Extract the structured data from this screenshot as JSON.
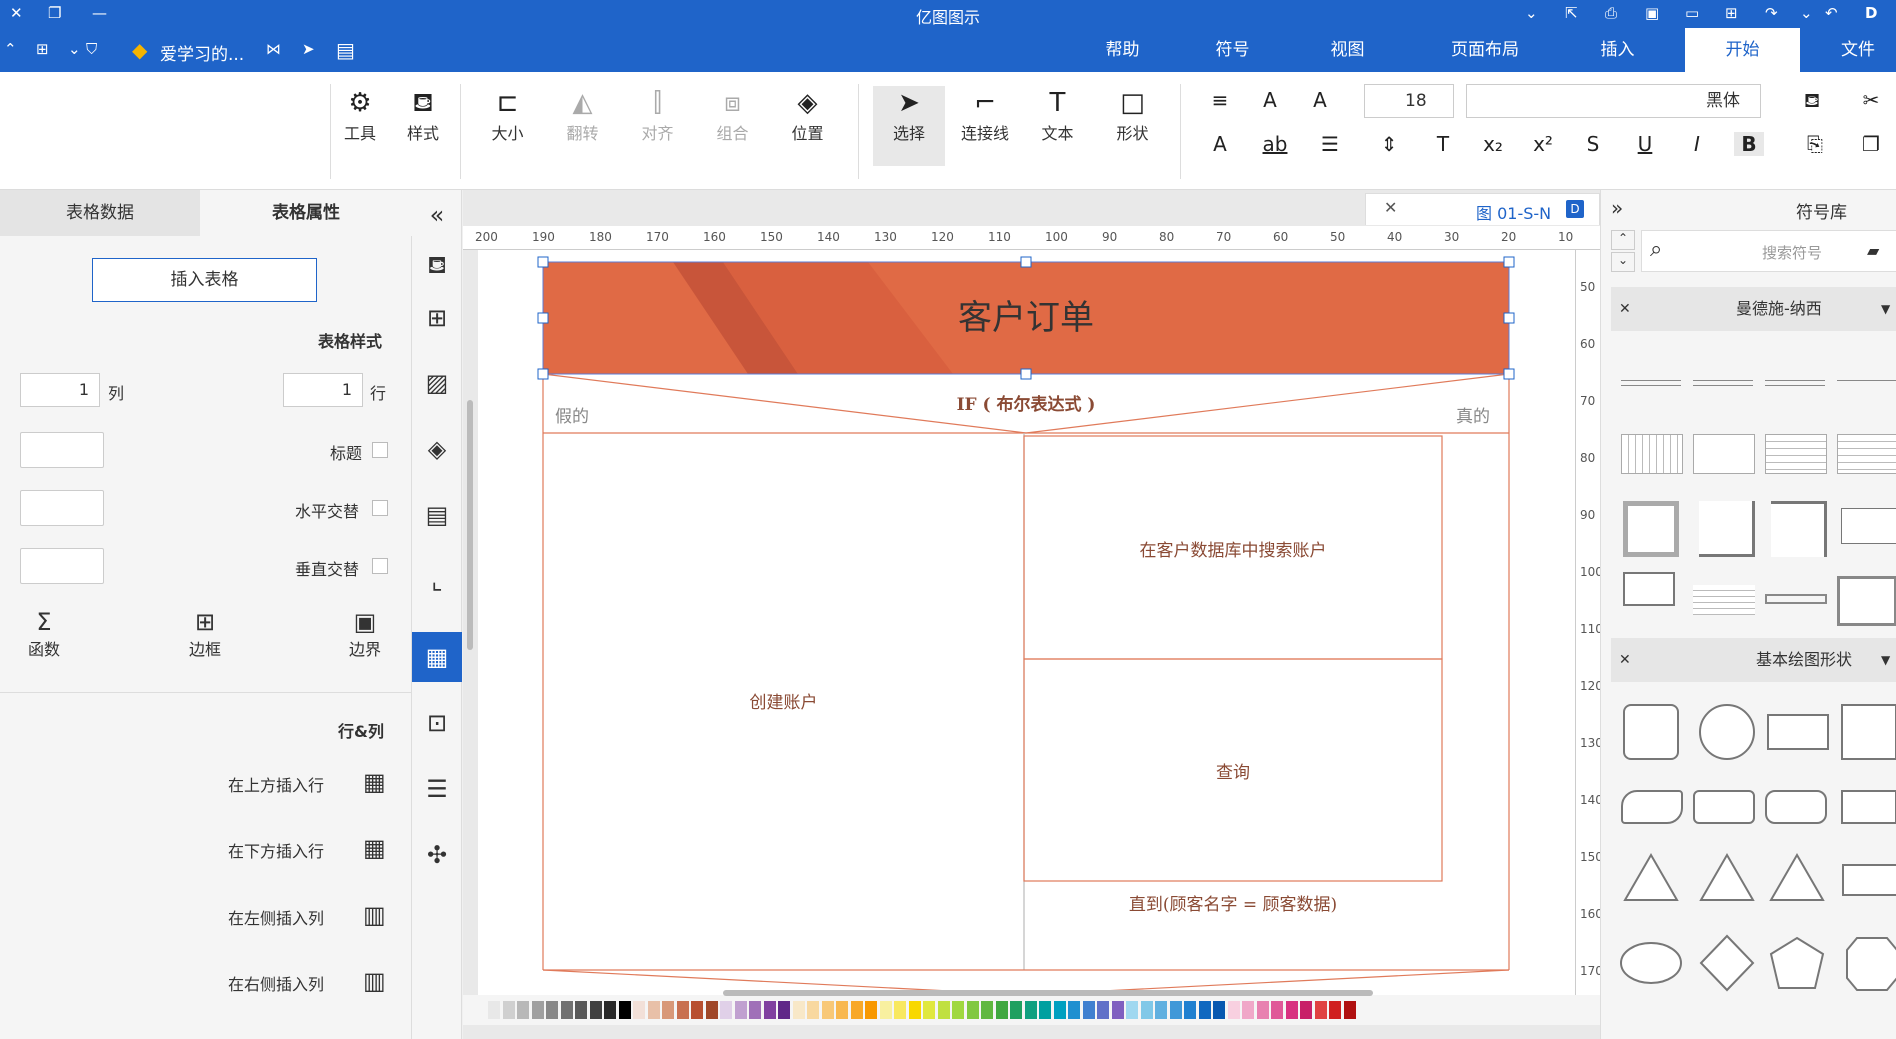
{
  "app": {
    "title": "亿图图示"
  },
  "menubar": {
    "tabs": [
      {
        "label": "开始"
      },
      {
        "label": "插入"
      },
      {
        "label": "页面布局"
      },
      {
        "label": "视图"
      },
      {
        "label": "符号"
      },
      {
        "label": "帮助"
      }
    ],
    "file_label": "文件",
    "tag_label": "爱学习的..."
  },
  "ribbon": {
    "font_name": "黑体",
    "font_size": "18",
    "shape_label": "形状",
    "text_label": "文本",
    "connector_label": "连接线",
    "select_label": "选择",
    "position_label": "位置",
    "group_label": "组合",
    "align_label": "对齐",
    "rotate_label": "翻转",
    "size_label": "大小",
    "style_label": "样式",
    "tools_label": "工具"
  },
  "left_panel": {
    "tab_props": "表格属性",
    "tab_data": "表格数据",
    "insert_table": "插入表格",
    "table_style_title": "表格样式",
    "row_label": "行",
    "row_value": "1",
    "col_label": "列",
    "col_value": "1",
    "header_label": "标题",
    "h_alt_label": "水平交替",
    "v_alt_label": "垂直交替",
    "border_label": "边界",
    "frame_label": "边框",
    "func_label": "函数",
    "rowcol_title": "行&列",
    "insert_above": "在上方插入行",
    "insert_below": "在下方插入行",
    "insert_left": "在左侧插入列",
    "insert_right": "在右侧插入列"
  },
  "document": {
    "tab_name": "图 01-S-N",
    "title": "客户订单",
    "if_expr": "IF ( 布尔表达式 )",
    "true_label": "真的",
    "false_label": "假的",
    "search_db": "在客户数据库中搜索账户",
    "query": "查询",
    "create_account": "创建账户",
    "until_cond": "直到(顾客名字 = 顾客数据)"
  },
  "ruler": {
    "h_ticks": [
      "10",
      "20",
      "30",
      "40",
      "50",
      "60",
      "70",
      "80",
      "90",
      "100",
      "110",
      "120",
      "130",
      "140",
      "150",
      "160",
      "170",
      "180",
      "190",
      "200"
    ],
    "v_ticks": [
      "50",
      "60",
      "70",
      "80",
      "90",
      "100",
      "110",
      "120",
      "130",
      "140",
      "150",
      "160",
      "170"
    ]
  },
  "right_panel": {
    "title": "符号库",
    "search_placeholder": "搜索符号",
    "lib1": "曼德施-纳西",
    "lib2": "基本绘图形状"
  },
  "colors": {
    "accent": "#1f64c9",
    "header_fill": "#e06a45",
    "header_stripe": "#c8553a",
    "line": "#e07a5a"
  }
}
